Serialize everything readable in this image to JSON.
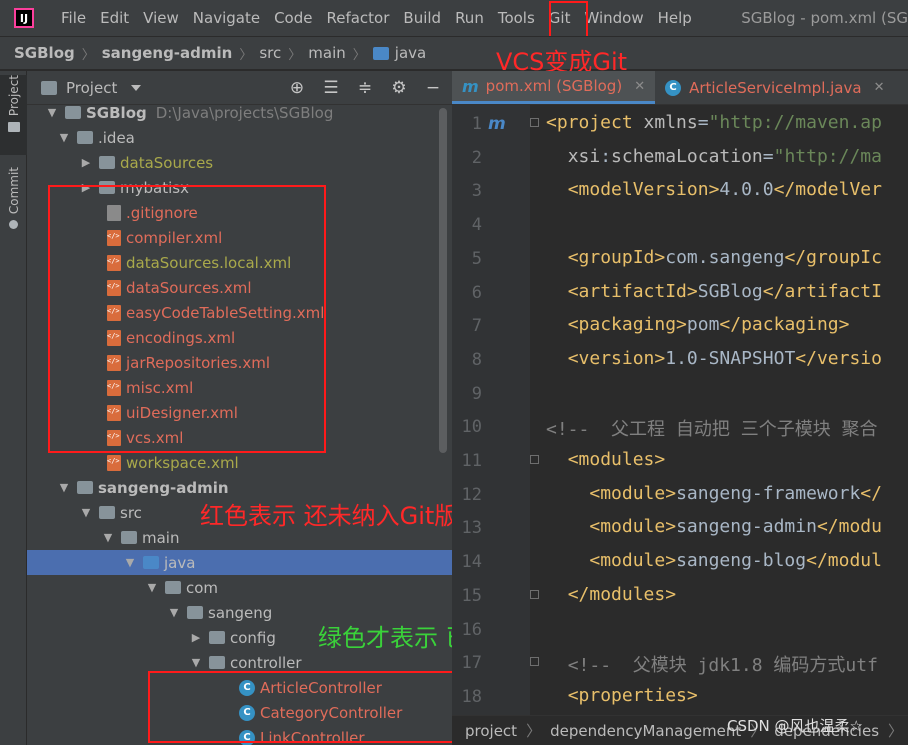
{
  "menubar": {
    "logo": "IJ",
    "items": [
      "File",
      "Edit",
      "View",
      "Navigate",
      "Code",
      "Refactor",
      "Build",
      "Run",
      "Tools",
      "Git",
      "Window",
      "Help"
    ],
    "window_title": "SGBlog - pom.xml (SG"
  },
  "breadcrumb": {
    "items": [
      "SGBlog",
      "sangeng-admin",
      "src",
      "main",
      "java"
    ]
  },
  "annotations": {
    "vcs_to_git": "VCS变成Git",
    "red_untracked": "红色表示 还未纳入Git版本控制",
    "green_tracked": "绿色才表示 已经纳入Git版本控制"
  },
  "toolstrip": {
    "project_tab": "Project",
    "commit_tab": "Commit"
  },
  "project_panel": {
    "title": "Project",
    "tool_icons": [
      "crosshair-icon",
      "expand-all-icon",
      "collapse-all-icon",
      "gear-icon",
      "minimize-icon"
    ]
  },
  "tree": {
    "rows": [
      {
        "label": "SGBlog",
        "hint": "D:\\Java\\projects\\SGBlog"
      },
      {
        "label": ".idea"
      },
      {
        "label": "dataSources"
      },
      {
        "label": "mybatisx"
      },
      {
        "label": ".gitignore"
      },
      {
        "label": "compiler.xml"
      },
      {
        "label": "dataSources.local.xml"
      },
      {
        "label": "dataSources.xml"
      },
      {
        "label": "easyCodeTableSetting.xml"
      },
      {
        "label": "encodings.xml"
      },
      {
        "label": "jarRepositories.xml"
      },
      {
        "label": "misc.xml"
      },
      {
        "label": "uiDesigner.xml"
      },
      {
        "label": "vcs.xml"
      },
      {
        "label": "workspace.xml"
      },
      {
        "label": "sangeng-admin"
      },
      {
        "label": "src"
      },
      {
        "label": "main"
      },
      {
        "label": "java"
      },
      {
        "label": "com"
      },
      {
        "label": "sangeng"
      },
      {
        "label": "config"
      },
      {
        "label": "controller"
      },
      {
        "label": "ArticleController"
      },
      {
        "label": "CategoryController"
      },
      {
        "label": "LinkController"
      }
    ]
  },
  "editor": {
    "tabs": [
      {
        "label": "pom.xml (SGBlog)",
        "icon": "m"
      },
      {
        "label": "ArticleServiceImpl.java",
        "icon": "C"
      }
    ],
    "line_numbers": [
      "1",
      "2",
      "3",
      "4",
      "5",
      "6",
      "7",
      "8",
      "9",
      "10",
      "11",
      "12",
      "13",
      "14",
      "15",
      "16",
      "17",
      "18"
    ],
    "lines": [
      [
        {
          "c": "tag",
          "t": "<project "
        },
        {
          "c": "attr",
          "t": "xmlns"
        },
        {
          "c": "txt",
          "t": "="
        },
        {
          "c": "str",
          "t": "\"http://maven.ap"
        }
      ],
      [
        {
          "c": "txt",
          "t": "  "
        },
        {
          "c": "attr",
          "t": "xsi"
        },
        {
          "c": "txt",
          "t": ":"
        },
        {
          "c": "attr",
          "t": "schemaLocation"
        },
        {
          "c": "txt",
          "t": "="
        },
        {
          "c": "str",
          "t": "\"http://ma"
        }
      ],
      [
        {
          "c": "txt",
          "t": "  "
        },
        {
          "c": "tag",
          "t": "<modelVersion>"
        },
        {
          "c": "txt",
          "t": "4.0.0"
        },
        {
          "c": "tag",
          "t": "</modelVer"
        }
      ],
      [],
      [
        {
          "c": "txt",
          "t": "  "
        },
        {
          "c": "tag",
          "t": "<groupId>"
        },
        {
          "c": "txt",
          "t": "com.sangeng"
        },
        {
          "c": "tag",
          "t": "</groupIc"
        }
      ],
      [
        {
          "c": "txt",
          "t": "  "
        },
        {
          "c": "tag",
          "t": "<artifactId>"
        },
        {
          "c": "txt",
          "t": "SGBlog"
        },
        {
          "c": "tag",
          "t": "</artifactI"
        }
      ],
      [
        {
          "c": "txt",
          "t": "  "
        },
        {
          "c": "tag",
          "t": "<packaging>"
        },
        {
          "c": "txt",
          "t": "pom"
        },
        {
          "c": "tag",
          "t": "</packaging>"
        }
      ],
      [
        {
          "c": "txt",
          "t": "  "
        },
        {
          "c": "tag",
          "t": "<version>"
        },
        {
          "c": "txt",
          "t": "1.0-SNAPSHOT"
        },
        {
          "c": "tag",
          "t": "</versio"
        }
      ],
      [],
      [
        {
          "c": "cmt",
          "t": "<!--  父工程 自动把 三个子模块 聚合"
        }
      ],
      [
        {
          "c": "txt",
          "t": "  "
        },
        {
          "c": "tag",
          "t": "<modules>"
        }
      ],
      [
        {
          "c": "txt",
          "t": "    "
        },
        {
          "c": "tag",
          "t": "<module>"
        },
        {
          "c": "txt",
          "t": "sangeng-framework"
        },
        {
          "c": "tag",
          "t": "</"
        }
      ],
      [
        {
          "c": "txt",
          "t": "    "
        },
        {
          "c": "tag",
          "t": "<module>"
        },
        {
          "c": "txt",
          "t": "sangeng-admin"
        },
        {
          "c": "tag",
          "t": "</modu"
        }
      ],
      [
        {
          "c": "txt",
          "t": "    "
        },
        {
          "c": "tag",
          "t": "<module>"
        },
        {
          "c": "txt",
          "t": "sangeng-blog"
        },
        {
          "c": "tag",
          "t": "</modul"
        }
      ],
      [
        {
          "c": "txt",
          "t": "  "
        },
        {
          "c": "tag",
          "t": "</modules>"
        }
      ],
      [],
      [
        {
          "c": "txt",
          "t": "  "
        },
        {
          "c": "cmt",
          "t": "<!--  父模块 jdk1.8 编码方式utf"
        }
      ],
      [
        {
          "c": "txt",
          "t": "  "
        },
        {
          "c": "tag",
          "t": "<properties>"
        }
      ]
    ]
  },
  "bottombar": {
    "items": [
      "project",
      "dependencyManagement",
      "dependencies",
      "de"
    ]
  },
  "watermark": "CSDN @风也温柔☆"
}
